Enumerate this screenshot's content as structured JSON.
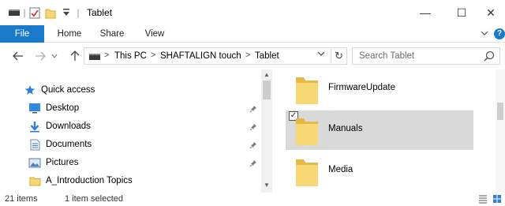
{
  "window": {
    "title": "Tablet",
    "minimize": "—",
    "maximize": "☐",
    "close": "✕"
  },
  "ribbon": {
    "tabs": [
      "File",
      "Home",
      "Share",
      "View"
    ]
  },
  "address": {
    "crumbs": [
      "This PC",
      "SHAFTALIGN touch",
      "Tablet"
    ]
  },
  "search": {
    "placeholder": "Search Tablet"
  },
  "nav_pane": {
    "quick_access": "Quick access",
    "items": [
      {
        "label": "Desktop",
        "icon": "desktop-icon",
        "pinned": true
      },
      {
        "label": "Downloads",
        "icon": "downloads-icon",
        "pinned": true
      },
      {
        "label": "Documents",
        "icon": "documents-icon",
        "pinned": true
      },
      {
        "label": "Pictures",
        "icon": "pictures-icon",
        "pinned": true
      },
      {
        "label": "A_Introduction Topics",
        "icon": "folder-icon",
        "pinned": false
      }
    ]
  },
  "content": {
    "folders": [
      {
        "name": "FirmwareUpdate",
        "selected": false
      },
      {
        "name": "Manuals",
        "selected": true
      },
      {
        "name": "Media",
        "selected": false
      }
    ]
  },
  "status": {
    "count": "21 items",
    "selection": "1 item selected"
  },
  "colors": {
    "accent": "#1979ca",
    "selection": "#d9d9d9",
    "folder": "#f8d775"
  }
}
